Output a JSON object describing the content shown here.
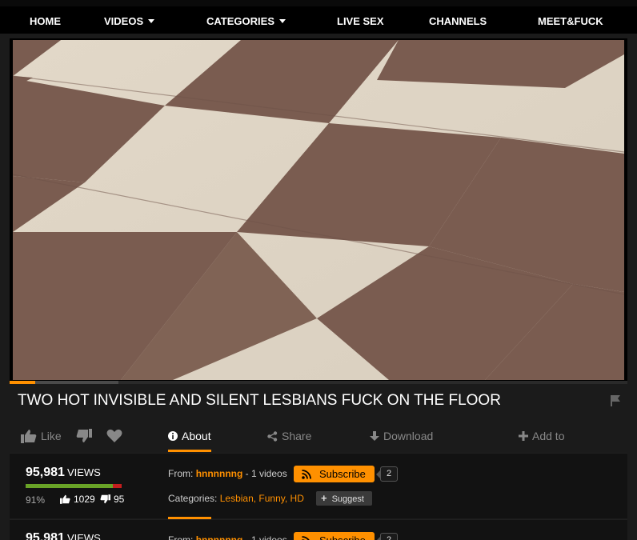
{
  "nav": {
    "home": "HOME",
    "videos": "VIDEOS",
    "categories": "CATEGORIES",
    "live_sex": "LIVE SEX",
    "channels": "CHANNELS",
    "meet": "MEET&FUCK"
  },
  "video": {
    "title": "TWO HOT INVISIBLE AND SILENT LESBIANS FUCK ON THE FLOOR"
  },
  "actions": {
    "like": "Like",
    "about": "About",
    "share": "Share",
    "download": "Download",
    "add_to": "Add to"
  },
  "stats": {
    "views": "95,981",
    "views_label": "VIEWS",
    "rating_pct": "91%",
    "rating_fraction": 0.91,
    "likes": "1029",
    "dislikes": "95"
  },
  "uploader": {
    "from_label": "From:",
    "name": "hnnnnnng",
    "videos": "- 1 videos",
    "subscribe": "Subscribe",
    "subscribers": "2"
  },
  "categories": {
    "label": "Categories:",
    "list": "Lesbian, Funny, HD",
    "suggest": "Suggest"
  },
  "colors": {
    "accent": "#ff9000",
    "rating_good": "#69a327",
    "rating_bad": "#c31e1e"
  }
}
